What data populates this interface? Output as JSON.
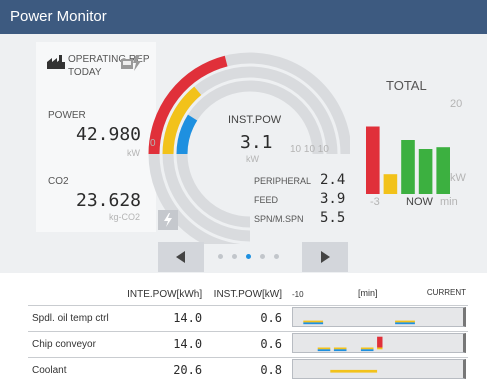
{
  "window": {
    "title": "Power Monitor"
  },
  "operating_report": {
    "title": "OPERATING REP",
    "period": "TODAY"
  },
  "power": {
    "label": "POWER",
    "value": "42.980",
    "unit": "kW"
  },
  "co2": {
    "label": "CO2",
    "value": "23.628",
    "unit": "kg-CO2"
  },
  "gauge": {
    "scale_min": "0",
    "inst_label": "INST.POW",
    "inst_value": "3.1",
    "inst_unit": "kW",
    "ring_ticks": "10 10 10",
    "red_ring_fraction": 0.42,
    "yellow_ring_fraction": 0.28,
    "blue_ring_fraction": 0.18
  },
  "breakdown": [
    {
      "label": "PERIPHERAL",
      "value": "2.4",
      "color": "#e0303a"
    },
    {
      "label": "FEED",
      "value": "3.9",
      "color": "#f2c21a"
    },
    {
      "label": "SPN/M.SPN",
      "value": "5.5",
      "color": "#1e90e0"
    }
  ],
  "total": {
    "title": "TOTAL",
    "ymax": "20",
    "unit": "kW",
    "x_start": "-3",
    "x_now": "NOW",
    "x_unit": "min",
    "series": [
      {
        "color": "#e0303a",
        "level": 0.75
      },
      {
        "color": "#f2c21a",
        "level": 0.22
      },
      {
        "color": "#3cb040",
        "level": 0.6
      },
      {
        "color": "#3cb040",
        "level": 0.5
      },
      {
        "color": "#3cb040",
        "level": 0.52
      }
    ]
  },
  "pager": {
    "prev_icon": "arrow-left",
    "next_icon": "arrow-right",
    "pages": 5,
    "active_page": 3
  },
  "table": {
    "headers": {
      "name": "",
      "inte": "INTE.POW[kWh]",
      "inst": "INST.POW[kW]",
      "trend_start": "-10",
      "trend_unit": "[min]",
      "trend_end": "CURRENT"
    },
    "rows": [
      {
        "name": "Spdl. oil temp ctrl",
        "inte": "14.0",
        "inst": "0.6"
      },
      {
        "name": "Chip conveyor",
        "inte": "14.0",
        "inst": "0.6"
      },
      {
        "name": "Coolant",
        "inte": "20.6",
        "inst": "0.8"
      }
    ]
  },
  "colors": {
    "title_bar": "#3d5a80",
    "red": "#e0303a",
    "yellow": "#f2c21a",
    "blue": "#1e90e0",
    "green": "#3cb040"
  }
}
